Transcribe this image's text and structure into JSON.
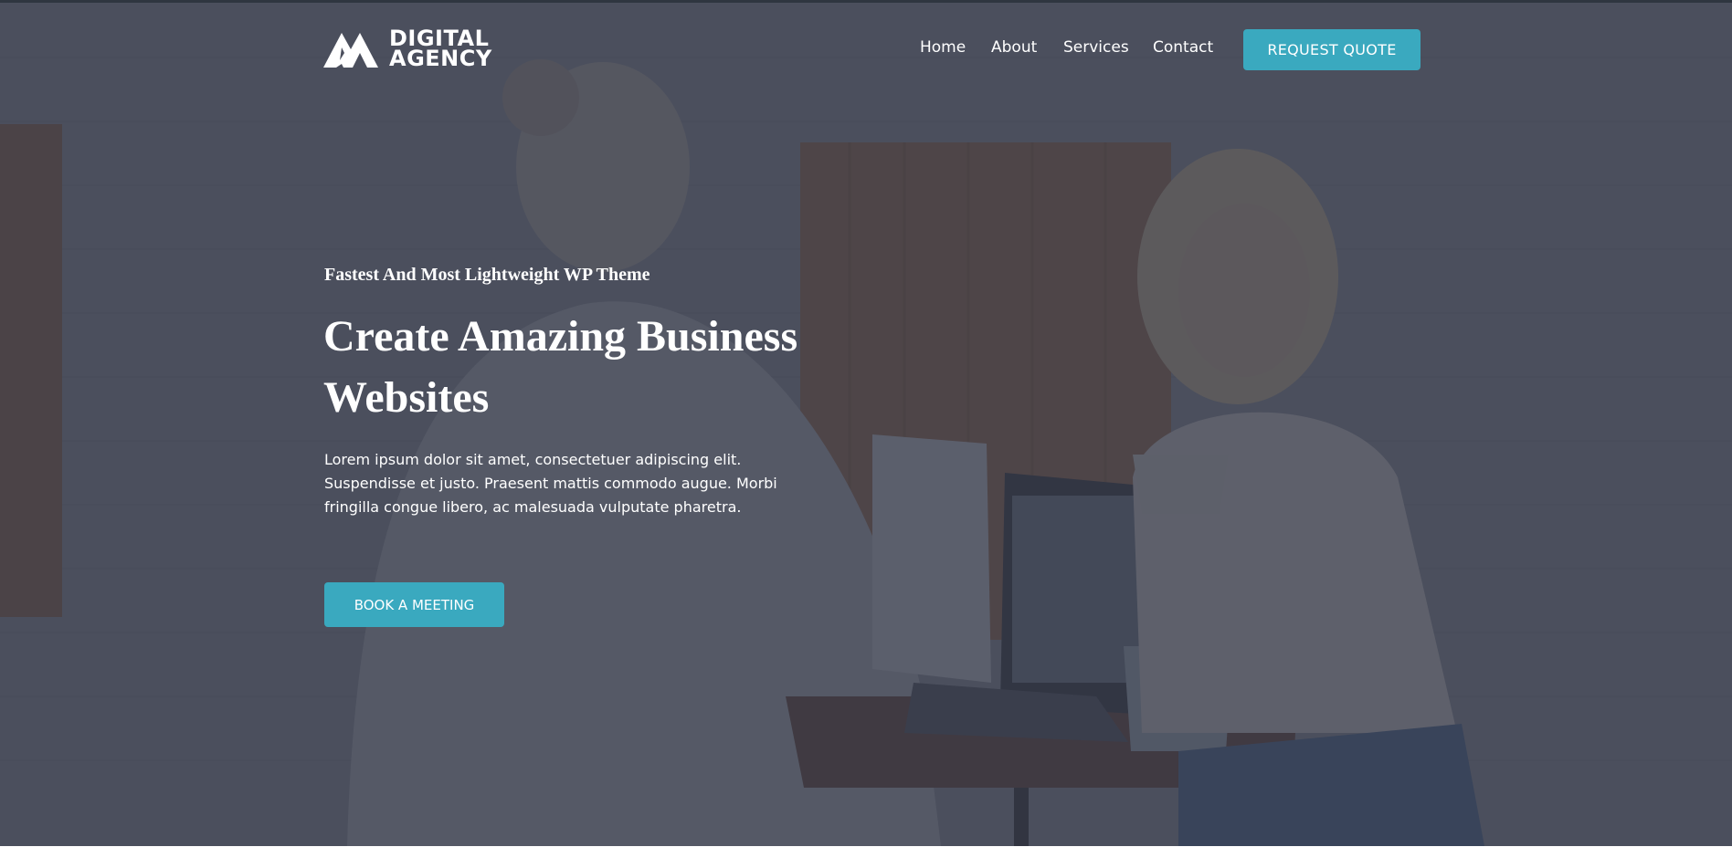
{
  "brand": {
    "logo_line1": "DIGITAL",
    "logo_line2": "AGENCY"
  },
  "nav": {
    "items": [
      {
        "label": "Home"
      },
      {
        "label": "About"
      },
      {
        "label": "Services"
      },
      {
        "label": "Contact"
      }
    ],
    "cta_label": "REQUEST QUOTE"
  },
  "hero": {
    "eyebrow": "Fastest And Most Lightweight WP Theme",
    "headline": "Create Amazing Business Websites",
    "body": "Lorem ipsum dolor sit amet, consectetuer adipiscing elit. Suspendisse et justo. Praesent mattis commodo augue. Morbi fringilla congue libero, ac malesuada vulputate pharetra.",
    "button_label": "BOOK A MEETING",
    "background_image": "two-women-cafe-laptop-photo"
  },
  "colors": {
    "accent": "#3aa9bf",
    "overlay": "#343848",
    "text": "#ffffff"
  }
}
